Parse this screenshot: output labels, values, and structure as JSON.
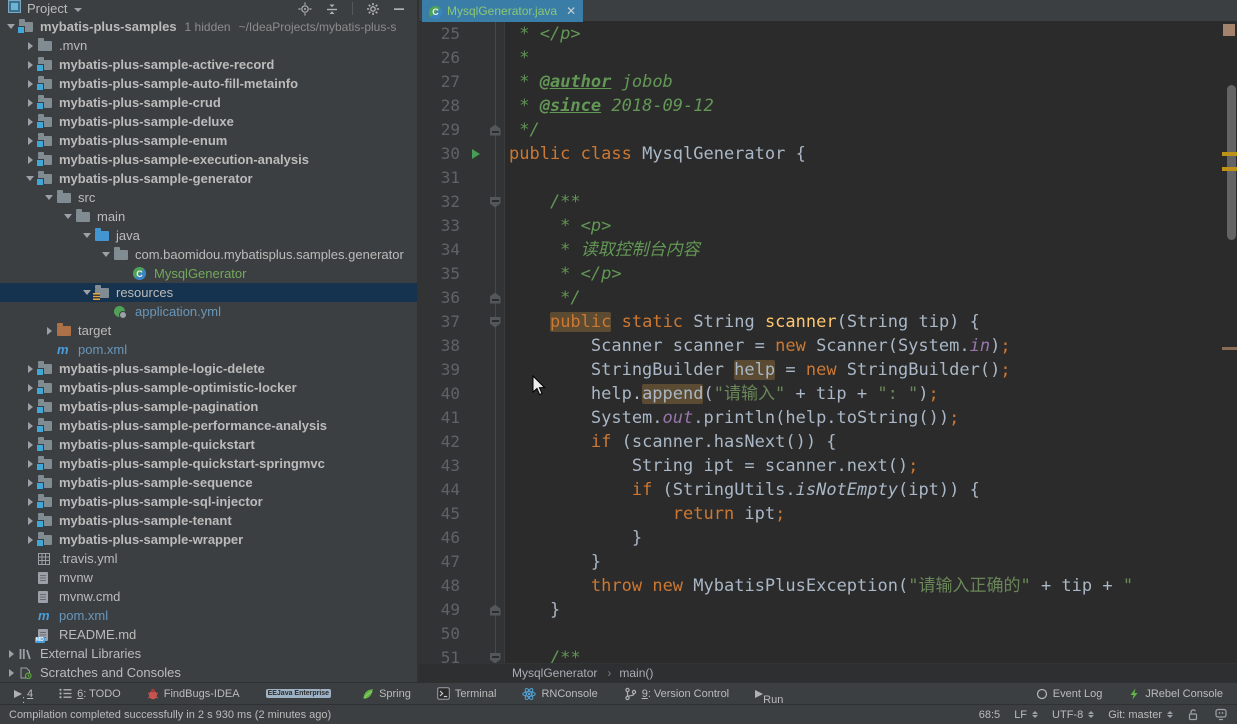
{
  "colors": {
    "panel_bg": "#3C3F41",
    "editor_bg": "#2B2B2B",
    "gutter_bg": "#313335",
    "tree_selection_bg": "#15334E",
    "tab_active_bg": "#3A7DA6",
    "tab_text_added": "#8BC873",
    "keyword": "#CC7832",
    "plain_text": "#A9B7C6",
    "comment": "#629755",
    "string": "#6A8759",
    "method_decl": "#FFC66D",
    "line_number": "#606366",
    "vcs_added": "#73A85C",
    "vcs_modified": "#6897BB",
    "identifier_highlight_bg": "#5A4B32",
    "run_arrow": "#499C54",
    "warn_stripe": "#BE9117"
  },
  "project_panel": {
    "title": "Project",
    "title_icon": "project-tool-icon",
    "header_icons": [
      "locate-icon",
      "collapse-all-icon",
      "divider",
      "settings-icon",
      "hide-icon"
    ],
    "tree": [
      {
        "level": 0,
        "state": "open",
        "icon": "module-folder-icon",
        "label": "mybatis-plus-samples",
        "bold": true,
        "suffixes": [
          "1 hidden",
          "~/IdeaProjects/mybatis-plus-s"
        ]
      },
      {
        "level": 1,
        "state": "closed",
        "icon": "folder-icon",
        "label": ".mvn"
      },
      {
        "level": 1,
        "state": "closed",
        "icon": "module-folder-icon",
        "label": "mybatis-plus-sample-active-record",
        "bold": true
      },
      {
        "level": 1,
        "state": "closed",
        "icon": "module-folder-icon",
        "label": "mybatis-plus-sample-auto-fill-metainfo",
        "bold": true
      },
      {
        "level": 1,
        "state": "closed",
        "icon": "module-folder-icon",
        "label": "mybatis-plus-sample-crud",
        "bold": true
      },
      {
        "level": 1,
        "state": "closed",
        "icon": "module-folder-icon",
        "label": "mybatis-plus-sample-deluxe",
        "bold": true
      },
      {
        "level": 1,
        "state": "closed",
        "icon": "module-folder-icon",
        "label": "mybatis-plus-sample-enum",
        "bold": true
      },
      {
        "level": 1,
        "state": "closed",
        "icon": "module-folder-icon",
        "label": "mybatis-plus-sample-execution-analysis",
        "bold": true
      },
      {
        "level": 1,
        "state": "open",
        "icon": "module-folder-icon",
        "label": "mybatis-plus-sample-generator",
        "bold": true
      },
      {
        "level": 2,
        "state": "open",
        "icon": "folder-icon",
        "label": "src"
      },
      {
        "level": 3,
        "state": "open",
        "icon": "folder-icon",
        "label": "main"
      },
      {
        "level": 4,
        "state": "open",
        "icon": "source-folder-icon",
        "label": "java"
      },
      {
        "level": 5,
        "state": "open",
        "icon": "package-folder-icon",
        "label": "com.baomidou.mybatisplus.samples.generator"
      },
      {
        "level": 6,
        "state": "none",
        "icon": "class-icon",
        "label": "MysqlGenerator",
        "color": "added"
      },
      {
        "level": 4,
        "state": "open",
        "icon": "resources-folder-icon",
        "label": "resources",
        "selected": true
      },
      {
        "level": 5,
        "state": "none",
        "icon": "yml-icon",
        "label": "application.yml",
        "color": "modified"
      },
      {
        "level": 2,
        "state": "closed",
        "icon": "excluded-folder-icon",
        "label": "target"
      },
      {
        "level": 2,
        "state": "none",
        "icon": "maven-icon",
        "label": "pom.xml",
        "color": "modified"
      },
      {
        "level": 1,
        "state": "closed",
        "icon": "module-folder-icon",
        "label": "mybatis-plus-sample-logic-delete",
        "bold": true
      },
      {
        "level": 1,
        "state": "closed",
        "icon": "module-folder-icon",
        "label": "mybatis-plus-sample-optimistic-locker",
        "bold": true
      },
      {
        "level": 1,
        "state": "closed",
        "icon": "module-folder-icon",
        "label": "mybatis-plus-sample-pagination",
        "bold": true
      },
      {
        "level": 1,
        "state": "closed",
        "icon": "module-folder-icon",
        "label": "mybatis-plus-sample-performance-analysis",
        "bold": true
      },
      {
        "level": 1,
        "state": "closed",
        "icon": "module-folder-icon",
        "label": "mybatis-plus-sample-quickstart",
        "bold": true
      },
      {
        "level": 1,
        "state": "closed",
        "icon": "module-folder-icon",
        "label": "mybatis-plus-sample-quickstart-springmvc",
        "bold": true
      },
      {
        "level": 1,
        "state": "closed",
        "icon": "module-folder-icon",
        "label": "mybatis-plus-sample-sequence",
        "bold": true
      },
      {
        "level": 1,
        "state": "closed",
        "icon": "module-folder-icon",
        "label": "mybatis-plus-sample-sql-injector",
        "bold": true
      },
      {
        "level": 1,
        "state": "closed",
        "icon": "module-folder-icon",
        "label": "mybatis-plus-sample-tenant",
        "bold": true
      },
      {
        "level": 1,
        "state": "closed",
        "icon": "module-folder-icon",
        "label": "mybatis-plus-sample-wrapper",
        "bold": true
      },
      {
        "level": 1,
        "state": "none",
        "icon": "table-icon",
        "label": ".travis.yml"
      },
      {
        "level": 1,
        "state": "none",
        "icon": "text-file-icon",
        "label": "mvnw"
      },
      {
        "level": 1,
        "state": "none",
        "icon": "text-file-icon",
        "label": "mvnw.cmd"
      },
      {
        "level": 1,
        "state": "none",
        "icon": "maven-icon",
        "label": "pom.xml",
        "color": "modified"
      },
      {
        "level": 1,
        "state": "none",
        "icon": "markdown-icon",
        "label": "README.md"
      },
      {
        "level": 0,
        "state": "closed",
        "icon": "library-icon",
        "label": "External Libraries"
      },
      {
        "level": 0,
        "state": "closed",
        "icon": "scratch-icon",
        "label": "Scratches and Consoles"
      }
    ]
  },
  "editor": {
    "tab": {
      "label": "MysqlGenerator.java",
      "icon": "class-icon",
      "close": "✕"
    },
    "breadcrumbs": [
      "MysqlGenerator",
      "main()"
    ],
    "lines": [
      {
        "n": 25,
        "tokens": [
          [
            "cmt",
            " * </p>"
          ]
        ]
      },
      {
        "n": 26,
        "tokens": [
          [
            "cmt",
            " *"
          ]
        ]
      },
      {
        "n": 27,
        "tokens": [
          [
            "cmt",
            " * "
          ],
          [
            "tag",
            "@author"
          ],
          [
            "cmt",
            " jobob"
          ]
        ]
      },
      {
        "n": 28,
        "tokens": [
          [
            "cmt",
            " * "
          ],
          [
            "tag",
            "@since"
          ],
          [
            "cmt",
            " 2018-09-12"
          ]
        ]
      },
      {
        "n": 29,
        "fold": "end",
        "tokens": [
          [
            "cmt",
            " */"
          ]
        ]
      },
      {
        "n": 30,
        "run": true,
        "tokens": [
          [
            "kw",
            "public class "
          ],
          [
            "pl",
            "MysqlGenerator {"
          ]
        ]
      },
      {
        "n": 31,
        "tokens": []
      },
      {
        "n": 32,
        "fold": "start",
        "tokens": [
          [
            "cmt",
            "    /**"
          ]
        ]
      },
      {
        "n": 33,
        "tokens": [
          [
            "cmt",
            "     * <p>"
          ]
        ]
      },
      {
        "n": 34,
        "tokens": [
          [
            "cmt",
            "     * 读取控制台内容"
          ]
        ]
      },
      {
        "n": 35,
        "tokens": [
          [
            "cmt",
            "     * </p>"
          ]
        ]
      },
      {
        "n": 36,
        "fold": "end",
        "tokens": [
          [
            "cmt",
            "     */"
          ]
        ]
      },
      {
        "n": 37,
        "fold": "start",
        "tokens": [
          [
            "pl",
            "    "
          ],
          [
            "kw hl",
            "public"
          ],
          [
            "pl",
            " "
          ],
          [
            "kw",
            "static"
          ],
          [
            "pl",
            " String "
          ],
          [
            "mth",
            "scanner"
          ],
          [
            "pl",
            "(String tip) {"
          ]
        ]
      },
      {
        "n": 38,
        "tokens": [
          [
            "pl",
            "        Scanner scanner = "
          ],
          [
            "kw",
            "new"
          ],
          [
            "pl",
            " Scanner(System."
          ],
          [
            "fld",
            "in"
          ],
          [
            "pl",
            ")"
          ],
          [
            "smc",
            ";"
          ]
        ]
      },
      {
        "n": 39,
        "tokens": [
          [
            "pl",
            "        StringBuilder "
          ],
          [
            "pl hl",
            "help"
          ],
          [
            "pl",
            " = "
          ],
          [
            "kw",
            "new"
          ],
          [
            "pl",
            " StringBuilder()"
          ],
          [
            "smc",
            ";"
          ]
        ]
      },
      {
        "n": 40,
        "tokens": [
          [
            "pl",
            "        help."
          ],
          [
            "pl hl",
            "append"
          ],
          [
            "pl",
            "("
          ],
          [
            "str",
            "\"请输入\""
          ],
          [
            "pl",
            " + tip + "
          ],
          [
            "str",
            "\": \""
          ],
          [
            "pl",
            ")"
          ],
          [
            "smc",
            ";"
          ]
        ]
      },
      {
        "n": 41,
        "tokens": [
          [
            "pl",
            "        System."
          ],
          [
            "fld",
            "out"
          ],
          [
            "pl",
            ".println(help.toString())"
          ],
          [
            "smc",
            ";"
          ]
        ]
      },
      {
        "n": 42,
        "tokens": [
          [
            "pl",
            "        "
          ],
          [
            "kw",
            "if"
          ],
          [
            "pl",
            " (scanner.hasNext()) {"
          ]
        ]
      },
      {
        "n": 43,
        "tokens": [
          [
            "pl",
            "            String ipt = scanner.next()"
          ],
          [
            "smc",
            ";"
          ]
        ]
      },
      {
        "n": 44,
        "tokens": [
          [
            "pl",
            "            "
          ],
          [
            "kw",
            "if"
          ],
          [
            "pl",
            " (StringUtils."
          ],
          [
            "mthi",
            "isNotEmpty"
          ],
          [
            "pl",
            "(ipt)) {"
          ]
        ]
      },
      {
        "n": 45,
        "tokens": [
          [
            "pl",
            "                "
          ],
          [
            "kw",
            "return"
          ],
          [
            "pl",
            " ipt"
          ],
          [
            "smc",
            ";"
          ]
        ]
      },
      {
        "n": 46,
        "tokens": [
          [
            "pl",
            "            }"
          ]
        ]
      },
      {
        "n": 47,
        "tokens": [
          [
            "pl",
            "        }"
          ]
        ]
      },
      {
        "n": 48,
        "tokens": [
          [
            "pl",
            "        "
          ],
          [
            "kw",
            "throw"
          ],
          [
            "pl",
            " "
          ],
          [
            "kw",
            "new"
          ],
          [
            "pl",
            " MybatisPlusException("
          ],
          [
            "str",
            "\"请输入正确的\""
          ],
          [
            "pl",
            " + tip + "
          ],
          [
            "str",
            "\""
          ]
        ]
      },
      {
        "n": 49,
        "fold": "end",
        "tokens": [
          [
            "pl",
            "    }"
          ]
        ]
      },
      {
        "n": 50,
        "tokens": []
      },
      {
        "n": 51,
        "fold": "start",
        "tokens": [
          [
            "cmt",
            "    /**"
          ]
        ]
      }
    ]
  },
  "toolbar": {
    "left": [
      {
        "icon": "run-icon",
        "num": "4",
        "label": ": Run"
      },
      {
        "icon": "todo-icon",
        "num": "6",
        "label": ": TODO"
      },
      {
        "icon": "findbugs-icon",
        "label": "FindBugs-IDEA"
      },
      {
        "icon": "javaee-icon",
        "label": "Java Enterprise"
      },
      {
        "icon": "spring-icon",
        "label": "Spring"
      },
      {
        "icon": "terminal-icon",
        "label": "Terminal"
      },
      {
        "icon": "react-icon",
        "label": "RNConsole"
      },
      {
        "icon": "branch-icon",
        "num": "9",
        "label": ": Version Control"
      },
      {
        "icon": "run-dashboard-icon",
        "label": "Run Dashboard"
      }
    ],
    "right": [
      {
        "icon": "event-log-icon",
        "label": "Event Log"
      },
      {
        "icon": "jrebel-icon",
        "label": "JRebel Console"
      }
    ]
  },
  "status_bar": {
    "message": "Compilation completed successfully in 2 s 930 ms (2 minutes ago)",
    "right": [
      {
        "label": "68:5"
      },
      {
        "label": "LF",
        "arrows": true
      },
      {
        "label": "UTF-8",
        "arrows": true
      },
      {
        "label": "Git: master",
        "arrows": true
      },
      {
        "icon": "unlock-icon"
      },
      {
        "icon": "hector-icon"
      }
    ]
  }
}
